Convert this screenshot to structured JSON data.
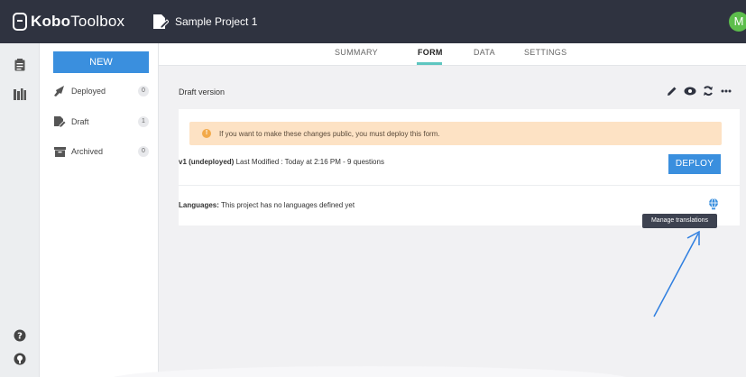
{
  "app": {
    "brand_bold": "Kobo",
    "brand_light": "Toolbox",
    "project_title": "Sample Project 1",
    "avatar_letter": "M"
  },
  "rail": {
    "icons": [
      "forms-icon",
      "library-icon",
      "help-icon",
      "github-icon"
    ]
  },
  "sidebar": {
    "new_label": "NEW",
    "items": [
      {
        "label": "Deployed",
        "count": "0",
        "icon": "rocket-icon"
      },
      {
        "label": "Draft",
        "count": "1",
        "icon": "draft-icon"
      },
      {
        "label": "Archived",
        "count": "0",
        "icon": "archive-icon"
      }
    ]
  },
  "tabs": [
    {
      "label": "SUMMARY",
      "active": false
    },
    {
      "label": "FORM",
      "active": true
    },
    {
      "label": "DATA",
      "active": false
    },
    {
      "label": "SETTINGS",
      "active": false
    }
  ],
  "form": {
    "draft_label": "Draft version",
    "tools": [
      "pencil-icon",
      "eye-icon",
      "refresh-icon",
      "more-icon"
    ],
    "warning": "If you want to make these changes public, you must deploy this form.",
    "version_bold": "v1 (undeployed)",
    "version_rest": " Last Modified : Today at 2:16 PM - 9 questions",
    "deploy_label": "DEPLOY",
    "languages_bold": "Languages:",
    "languages_rest": " This project has no languages defined yet",
    "tooltip": "Manage translations"
  },
  "colors": {
    "topbar": "#2f3340",
    "primary": "#3a8fde",
    "accent_tab": "#5ec6c0",
    "warning_bg": "#fde2c4",
    "avatar": "#5dbe4c",
    "arrow": "#2f7fe0"
  }
}
